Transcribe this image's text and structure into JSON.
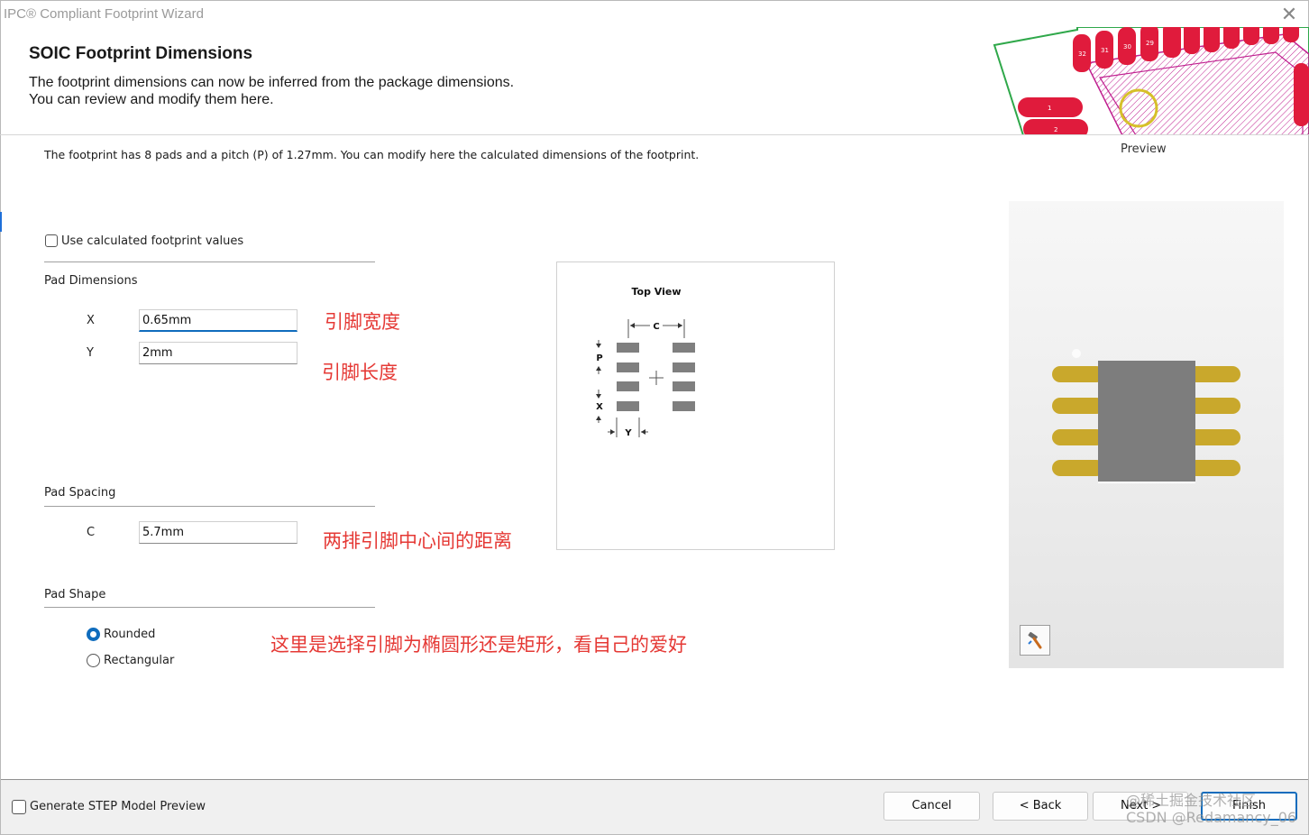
{
  "window": {
    "title": "IPC® Compliant Footprint Wizard",
    "close_glyph": "✕"
  },
  "header": {
    "title": "SOIC Footprint Dimensions",
    "line1": "The footprint dimensions can now be inferred from the package dimensions.",
    "line2": "You can review and modify them here."
  },
  "header_art": {
    "pad_numbers_top": [
      "32",
      "31",
      "30",
      "29"
    ],
    "pad_numbers_left": [
      "1",
      "2"
    ]
  },
  "info_text": "The footprint has 8 pads and a pitch (P) of 1.27mm. You can modify here the calculated dimensions of the footprint.",
  "use_calculated": {
    "label": "Use calculated footprint values",
    "checked": false
  },
  "pad_dimensions": {
    "heading": "Pad Dimensions",
    "x_label": "X",
    "x_value": "0.65mm",
    "y_label": "Y",
    "y_value": "2mm"
  },
  "pad_spacing": {
    "heading": "Pad Spacing",
    "c_label": "C",
    "c_value": "5.7mm"
  },
  "pad_shape": {
    "heading": "Pad Shape",
    "options": [
      {
        "label": "Rounded",
        "selected": true
      },
      {
        "label": "Rectangular",
        "selected": false
      }
    ]
  },
  "annotations": {
    "pad_width": "引脚宽度",
    "pad_length": "引脚长度",
    "row_distance": "两排引脚中心间的距离",
    "shape_note": "这里是选择引脚为椭圆形还是矩形，看自己的爱好"
  },
  "diagram": {
    "title": "Top View",
    "labels": {
      "c": "C",
      "p": "P",
      "x": "X",
      "y": "Y"
    }
  },
  "preview": {
    "label": "Preview"
  },
  "footer": {
    "step_label": "Generate STEP Model Preview",
    "step_checked": false,
    "cancel": "Cancel",
    "back": "< Back",
    "next": "Next >",
    "finish": "Finish"
  },
  "watermark": {
    "line1": "@稀土掘金技术社区",
    "line2": "CSDN @Redamancy_06"
  },
  "colors": {
    "accent": "#0f6cbd",
    "annotation": "#e53935",
    "pad_gold": "#c9a82c",
    "pcb_pad_red": "#e01b3c"
  }
}
